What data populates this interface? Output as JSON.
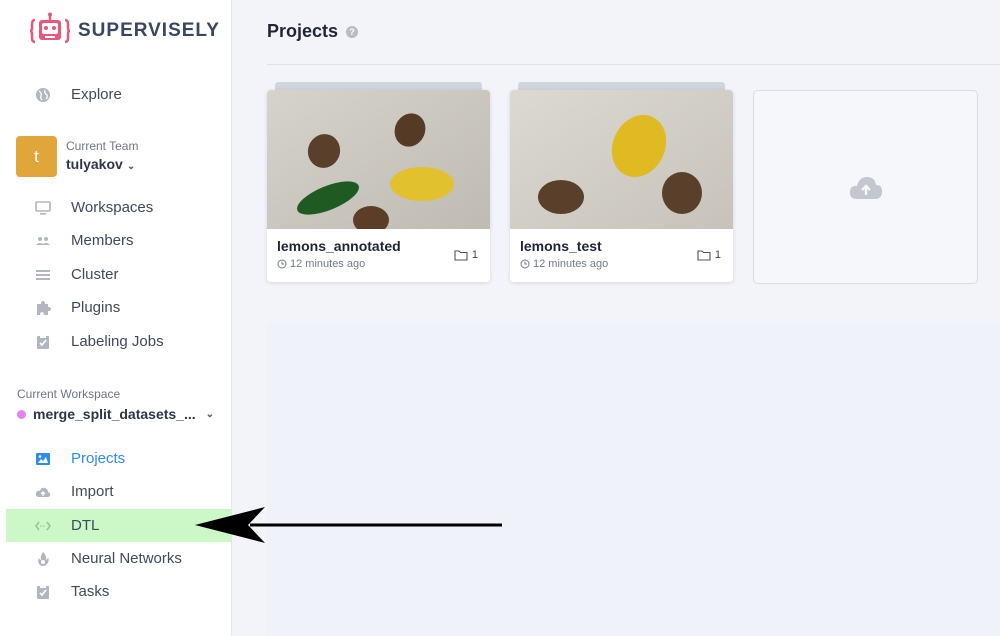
{
  "app": {
    "brand": "SUPERVISELY",
    "accent": "#2d8cf0"
  },
  "sidebar": {
    "explore": {
      "label": "Explore",
      "icon": "globe-icon"
    },
    "team": {
      "avatar_letter": "t",
      "caption": "Current Team",
      "name": "tulyakov"
    },
    "team_items": [
      {
        "label": "Workspaces",
        "icon": "monitor-icon"
      },
      {
        "label": "Members",
        "icon": "users-icon"
      },
      {
        "label": "Cluster",
        "icon": "list-icon"
      },
      {
        "label": "Plugins",
        "icon": "puzzle-icon"
      },
      {
        "label": "Labeling Jobs",
        "icon": "clipboard-check-icon"
      }
    ],
    "workspace": {
      "caption": "Current Workspace",
      "name": "merge_split_datasets_..."
    },
    "workspace_items": [
      {
        "label": "Projects",
        "icon": "images-icon",
        "active": true
      },
      {
        "label": "Import",
        "icon": "cloud-upload-icon"
      },
      {
        "label": "DTL",
        "icon": "code-arrows-icon",
        "highlighted": true
      },
      {
        "label": "Neural Networks",
        "icon": "flame-icon"
      },
      {
        "label": "Tasks",
        "icon": "clipboard-check-icon"
      }
    ]
  },
  "main": {
    "title": "Projects",
    "help": "?",
    "projects": [
      {
        "name": "lemons_annotated",
        "time": "12 minutes ago",
        "datasets": "1"
      },
      {
        "name": "lemons_test",
        "time": "12 minutes ago",
        "datasets": "1"
      }
    ],
    "upload": {
      "icon": "cloud-upload-icon"
    }
  }
}
